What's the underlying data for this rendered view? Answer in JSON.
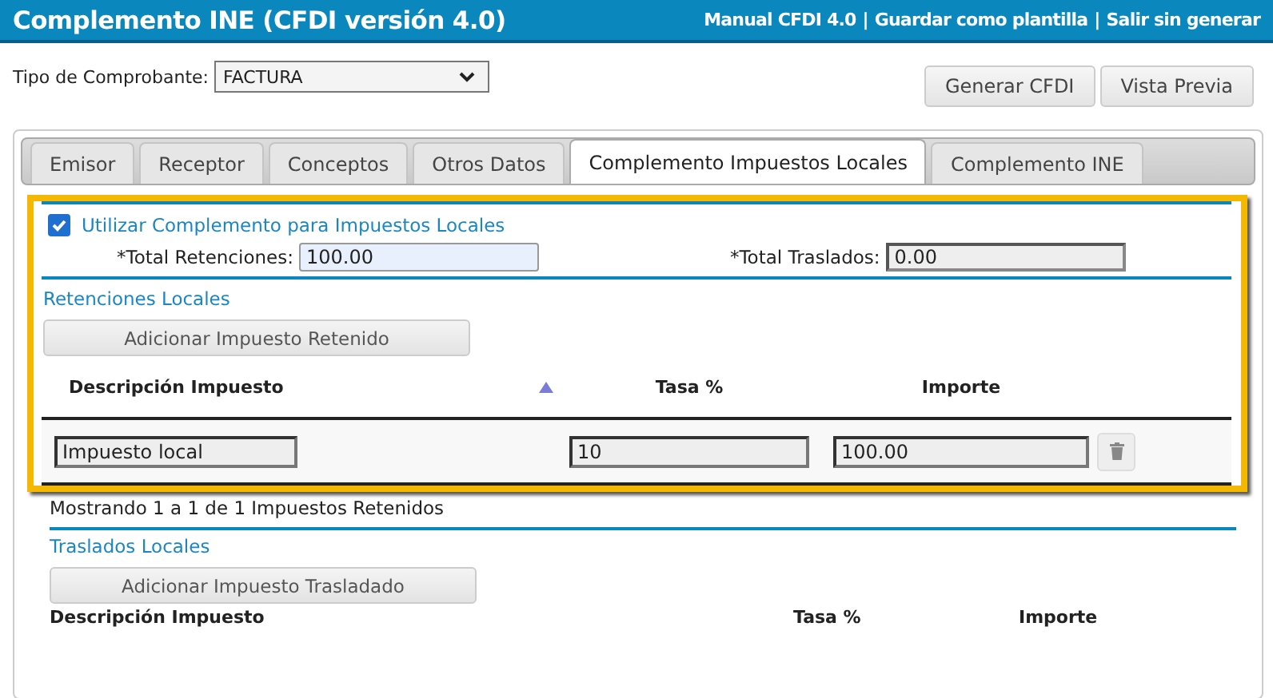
{
  "window": {
    "title": "Complemento INE (CFDI versión 4.0)"
  },
  "header_links": [
    "Manual CFDI 4.0",
    "Guardar como plantilla",
    "Salir sin generar"
  ],
  "link_separator": "|",
  "tipo_comprobante": {
    "label": "Tipo de Comprobante:",
    "value": "FACTURA"
  },
  "buttons": [
    "Generar CFDI",
    "Vista Previa"
  ],
  "tabs": [
    {
      "label": "Emisor",
      "selected": false
    },
    {
      "label": "Receptor",
      "selected": false
    },
    {
      "label": "Conceptos",
      "selected": false
    },
    {
      "label": "Otros Datos",
      "selected": false
    },
    {
      "label": "Complemento Impuestos Locales",
      "selected": true
    },
    {
      "label": "Complemento INE",
      "selected": false
    }
  ],
  "use_complement": {
    "label": "Utilizar Complemento para Impuestos Locales",
    "checked": true
  },
  "totals": [
    {
      "label": "*Total Retenciones:",
      "value": "100.00",
      "editable": true
    },
    {
      "label": "*Total Traslados:",
      "value": "0.00",
      "editable": false
    }
  ],
  "retenciones": {
    "title": "Retenciones Locales",
    "add_button": "Adicionar Impuesto Retenido",
    "columns": [
      "Descripción Impuesto",
      "Tasa %",
      "Importe"
    ],
    "rows": [
      {
        "descripcion": "Impuesto local",
        "tasa": "10",
        "importe": "100.00"
      }
    ],
    "summary": "Mostrando 1 a 1 de 1 Impuestos Retenidos"
  },
  "traslados": {
    "title": "Traslados Locales",
    "add_button": "Adicionar Impuesto Trasladado",
    "columns": [
      "Descripción Impuesto",
      "Tasa %",
      "Importe"
    ]
  }
}
